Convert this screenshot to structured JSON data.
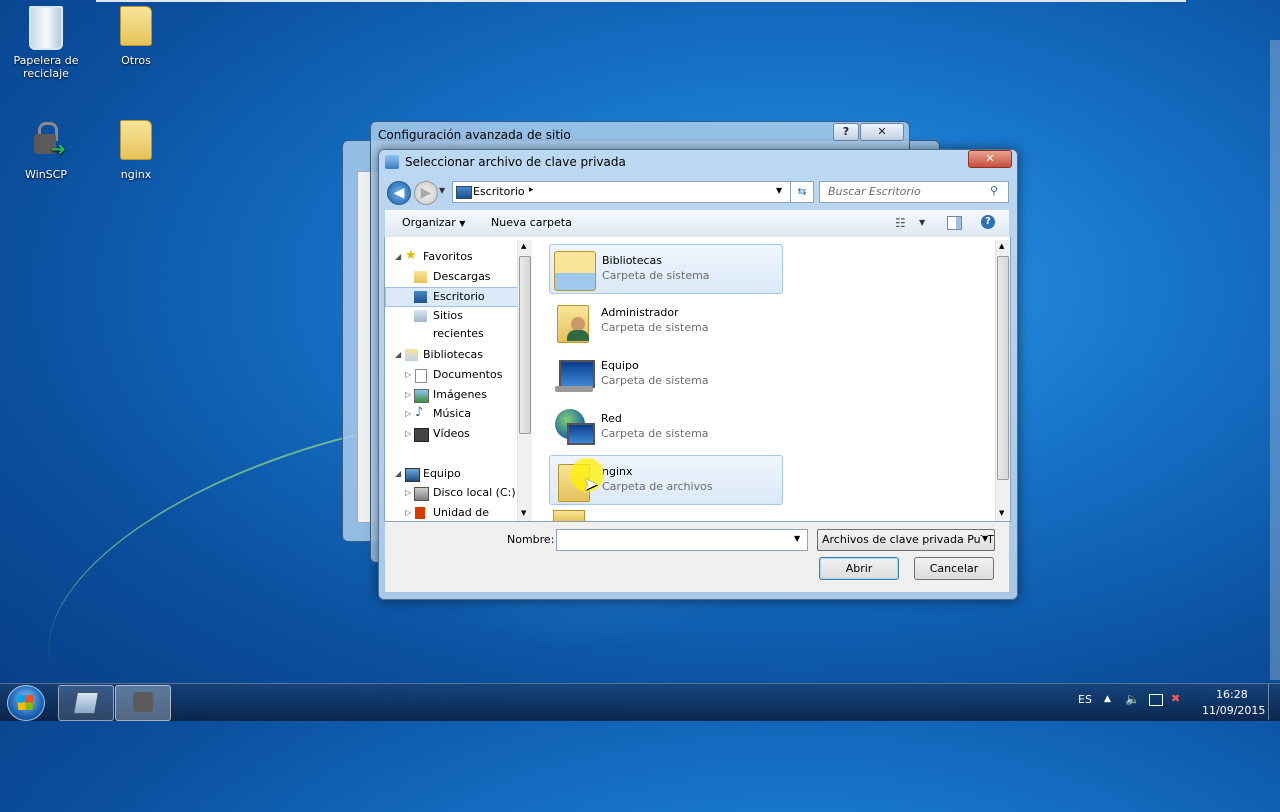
{
  "desktop": {
    "icons": [
      {
        "label": "Papelera de reciclaje"
      },
      {
        "label": "Otros"
      },
      {
        "label": "WinSCP"
      },
      {
        "label": "nginx"
      }
    ]
  },
  "back_window": {
    "title": "Configuración avanzada de sitio",
    "help_label": "?",
    "close_label": "✕"
  },
  "dialog": {
    "title": "Seleccionar archivo de clave privada",
    "close_label": "✕",
    "address": {
      "location": "Escritorio"
    },
    "search": {
      "placeholder": "Buscar Escritorio"
    },
    "toolbar": {
      "organize": "Organizar",
      "new_folder": "Nueva carpeta"
    },
    "nav": {
      "favorites": {
        "label": "Favoritos",
        "items": [
          "Descargas",
          "Escritorio",
          "Sitios recientes"
        ]
      },
      "libraries": {
        "label": "Bibliotecas",
        "items": [
          "Documentos",
          "Imágenes",
          "Música",
          "Vídeos"
        ]
      },
      "computer": {
        "label": "Equipo",
        "items": [
          "Disco local (C:)",
          "Unidad de DVD (I"
        ]
      }
    },
    "files": [
      {
        "name": "Bibliotecas",
        "type": "Carpeta de sistema",
        "icon": "libraries-icon"
      },
      {
        "name": "Administrador",
        "type": "Carpeta de sistema",
        "icon": "user-folder-icon"
      },
      {
        "name": "Equipo",
        "type": "Carpeta de sistema",
        "icon": "computer-icon"
      },
      {
        "name": "Red",
        "type": "Carpeta de sistema",
        "icon": "network-icon"
      },
      {
        "name": "nginx",
        "type": "Carpeta de archivos",
        "icon": "folder-icon"
      }
    ],
    "filename": {
      "label": "Nombre:",
      "value": ""
    },
    "filetype": {
      "selected": "Archivos de clave privada PuTT"
    },
    "buttons": {
      "open": "Abrir",
      "cancel": "Cancelar"
    }
  },
  "taskbar": {
    "language": "ES",
    "time": "16:28",
    "date": "11/09/2015"
  },
  "colors": {
    "selection": "#dce9f8",
    "accent": "#3c7fb1",
    "cursor_highlight": "#fff200"
  }
}
